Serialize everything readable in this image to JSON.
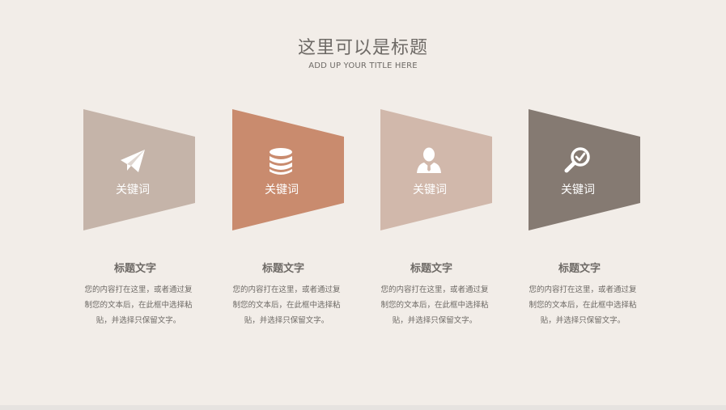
{
  "title": "这里可以是标题",
  "subtitle": "ADD UP YOUR TITLE HERE",
  "items": [
    {
      "keyword": "关键词",
      "icon": "paper-plane-icon",
      "color": "#c5b4a9",
      "heading": "标题文字",
      "desc_line1": "您的内容打在这里，或者通过复",
      "desc_line2": "制您的文本后，在此框中选择粘",
      "desc_line3": "贴，并选择只保留文字。"
    },
    {
      "keyword": "关键词",
      "icon": "database-icon",
      "color": "#c98b6e",
      "heading": "标题文字",
      "desc_line1": "您的内容打在这里，或者通过复",
      "desc_line2": "制您的文本后，在此框中选择粘",
      "desc_line3": "贴，并选择只保留文字。"
    },
    {
      "keyword": "关键词",
      "icon": "user-icon",
      "color": "#d1b8ab",
      "heading": "标题文字",
      "desc_line1": "您的内容打在这里，或者通过复",
      "desc_line2": "制您的文本后，在此框中选择粘",
      "desc_line3": "贴，并选择只保留文字。"
    },
    {
      "keyword": "关键词",
      "icon": "search-check-icon",
      "color": "#857a72",
      "heading": "标题文字",
      "desc_line1": "您的内容打在这里，或者通过复",
      "desc_line2": "制您的文本后，在此框中选择粘",
      "desc_line3": "贴，并选择只保留文字。"
    }
  ]
}
